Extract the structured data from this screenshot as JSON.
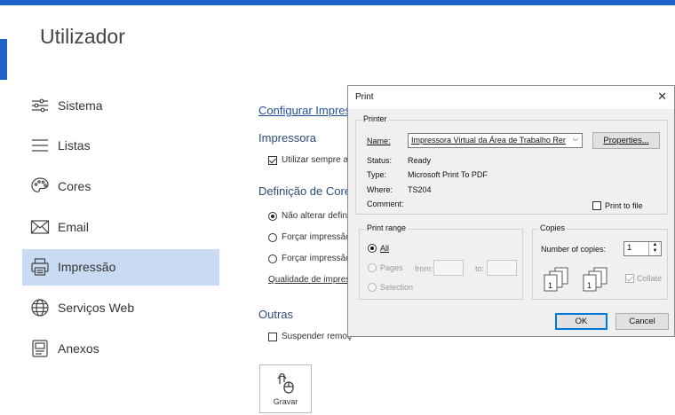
{
  "page": {
    "title": "Utilizador"
  },
  "nav": {
    "items": [
      {
        "label": "Sistema",
        "icon": "sliders-icon"
      },
      {
        "label": "Listas",
        "icon": "list-icon"
      },
      {
        "label": "Cores",
        "icon": "palette-icon"
      },
      {
        "label": "Email",
        "icon": "envelope-icon"
      },
      {
        "label": "Impressão",
        "icon": "printer-icon",
        "active": true
      },
      {
        "label": "Serviços Web",
        "icon": "globe-icon"
      },
      {
        "label": "Anexos",
        "icon": "attachment-icon"
      }
    ]
  },
  "main": {
    "configure_link": "Configurar Impres",
    "printer_heading": "Impressora",
    "always_use_label": "Utilizar sempre a i",
    "colors_heading": "Definição de Cores",
    "radio_1": "Não alterar definiç",
    "radio_2": "Forçar impressão",
    "radio_3": "Forçar impressão",
    "quality_label": "Qualidade de impressã",
    "others_heading": "Outras",
    "suspend_label": "Suspender remoç",
    "save_button": "Gravar"
  },
  "dialog": {
    "title": "Print",
    "printer_group": "Printer",
    "name_label": "Name:",
    "printer_name": "Impressora Virtual da Área de Trabalho Rer",
    "properties_button": "Properties...",
    "status_label": "Status:",
    "status_value": "Ready",
    "type_label": "Type:",
    "type_value": "Microsoft Print To PDF",
    "where_label": "Where:",
    "where_value": "TS204",
    "comment_label": "Comment:",
    "print_to_file": "Print to file",
    "print_range_group": "Print range",
    "all_label": "All",
    "pages_label": "Pages",
    "from_label": "from:",
    "to_label": "to:",
    "selection_label": "Selection",
    "copies_group": "Copies",
    "number_of_copies_label": "Number of copies:",
    "copies_value": "1",
    "collate_label": "Collate",
    "ok_button": "OK",
    "cancel_button": "Cancel"
  },
  "colors": {
    "accent": "#1f63c9",
    "active_nav": "#c9dbf3",
    "link": "#1f4f9a"
  }
}
